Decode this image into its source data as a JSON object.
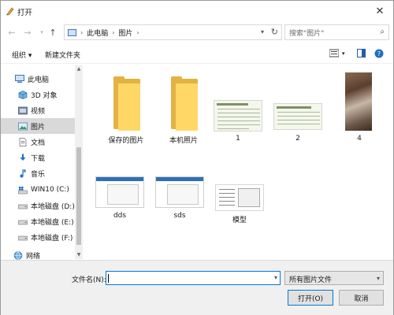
{
  "window": {
    "title": "打开"
  },
  "address": {
    "crumbs": [
      "此电脑",
      "图片"
    ]
  },
  "search": {
    "placeholder": "搜索\"图片\""
  },
  "toolbar": {
    "organize": "组织 ▾",
    "new_folder": "新建文件夹"
  },
  "sidebar": {
    "items": [
      {
        "label": "此电脑",
        "icon": "computer-icon"
      },
      {
        "label": "3D 对象",
        "icon": "cube-3d-icon"
      },
      {
        "label": "视频",
        "icon": "video-icon"
      },
      {
        "label": "图片",
        "icon": "pictures-icon",
        "selected": true
      },
      {
        "label": "文档",
        "icon": "document-icon"
      },
      {
        "label": "下载",
        "icon": "download-icon"
      },
      {
        "label": "音乐",
        "icon": "music-icon"
      },
      {
        "label": "WIN10 (C:)",
        "icon": "windows-drive-icon"
      },
      {
        "label": "本地磁盘 (D:)",
        "icon": "drive-icon"
      },
      {
        "label": "本地磁盘 (E:)",
        "icon": "drive-icon"
      },
      {
        "label": "本地磁盘 (F:)",
        "icon": "drive-icon"
      },
      {
        "label": "网络",
        "icon": "network-icon"
      }
    ]
  },
  "files": [
    {
      "name": "保存的图片",
      "kind": "folder"
    },
    {
      "name": "本机照片",
      "kind": "folder"
    },
    {
      "name": "1",
      "kind": "image"
    },
    {
      "name": "2",
      "kind": "image"
    },
    {
      "name": "4",
      "kind": "photo"
    },
    {
      "name": "dds",
      "kind": "image"
    },
    {
      "name": "sds",
      "kind": "image"
    },
    {
      "name": "模型",
      "kind": "image"
    }
  ],
  "bottom": {
    "filename_label": "文件名(N):",
    "filename_value": "",
    "filter_value": "所有图片文件",
    "open_label": "打开(O)",
    "cancel_label": "取消"
  },
  "colors": {
    "accent": "#0078d7",
    "selected_bg": "#d9d9d9",
    "folder": "#ffd766"
  }
}
